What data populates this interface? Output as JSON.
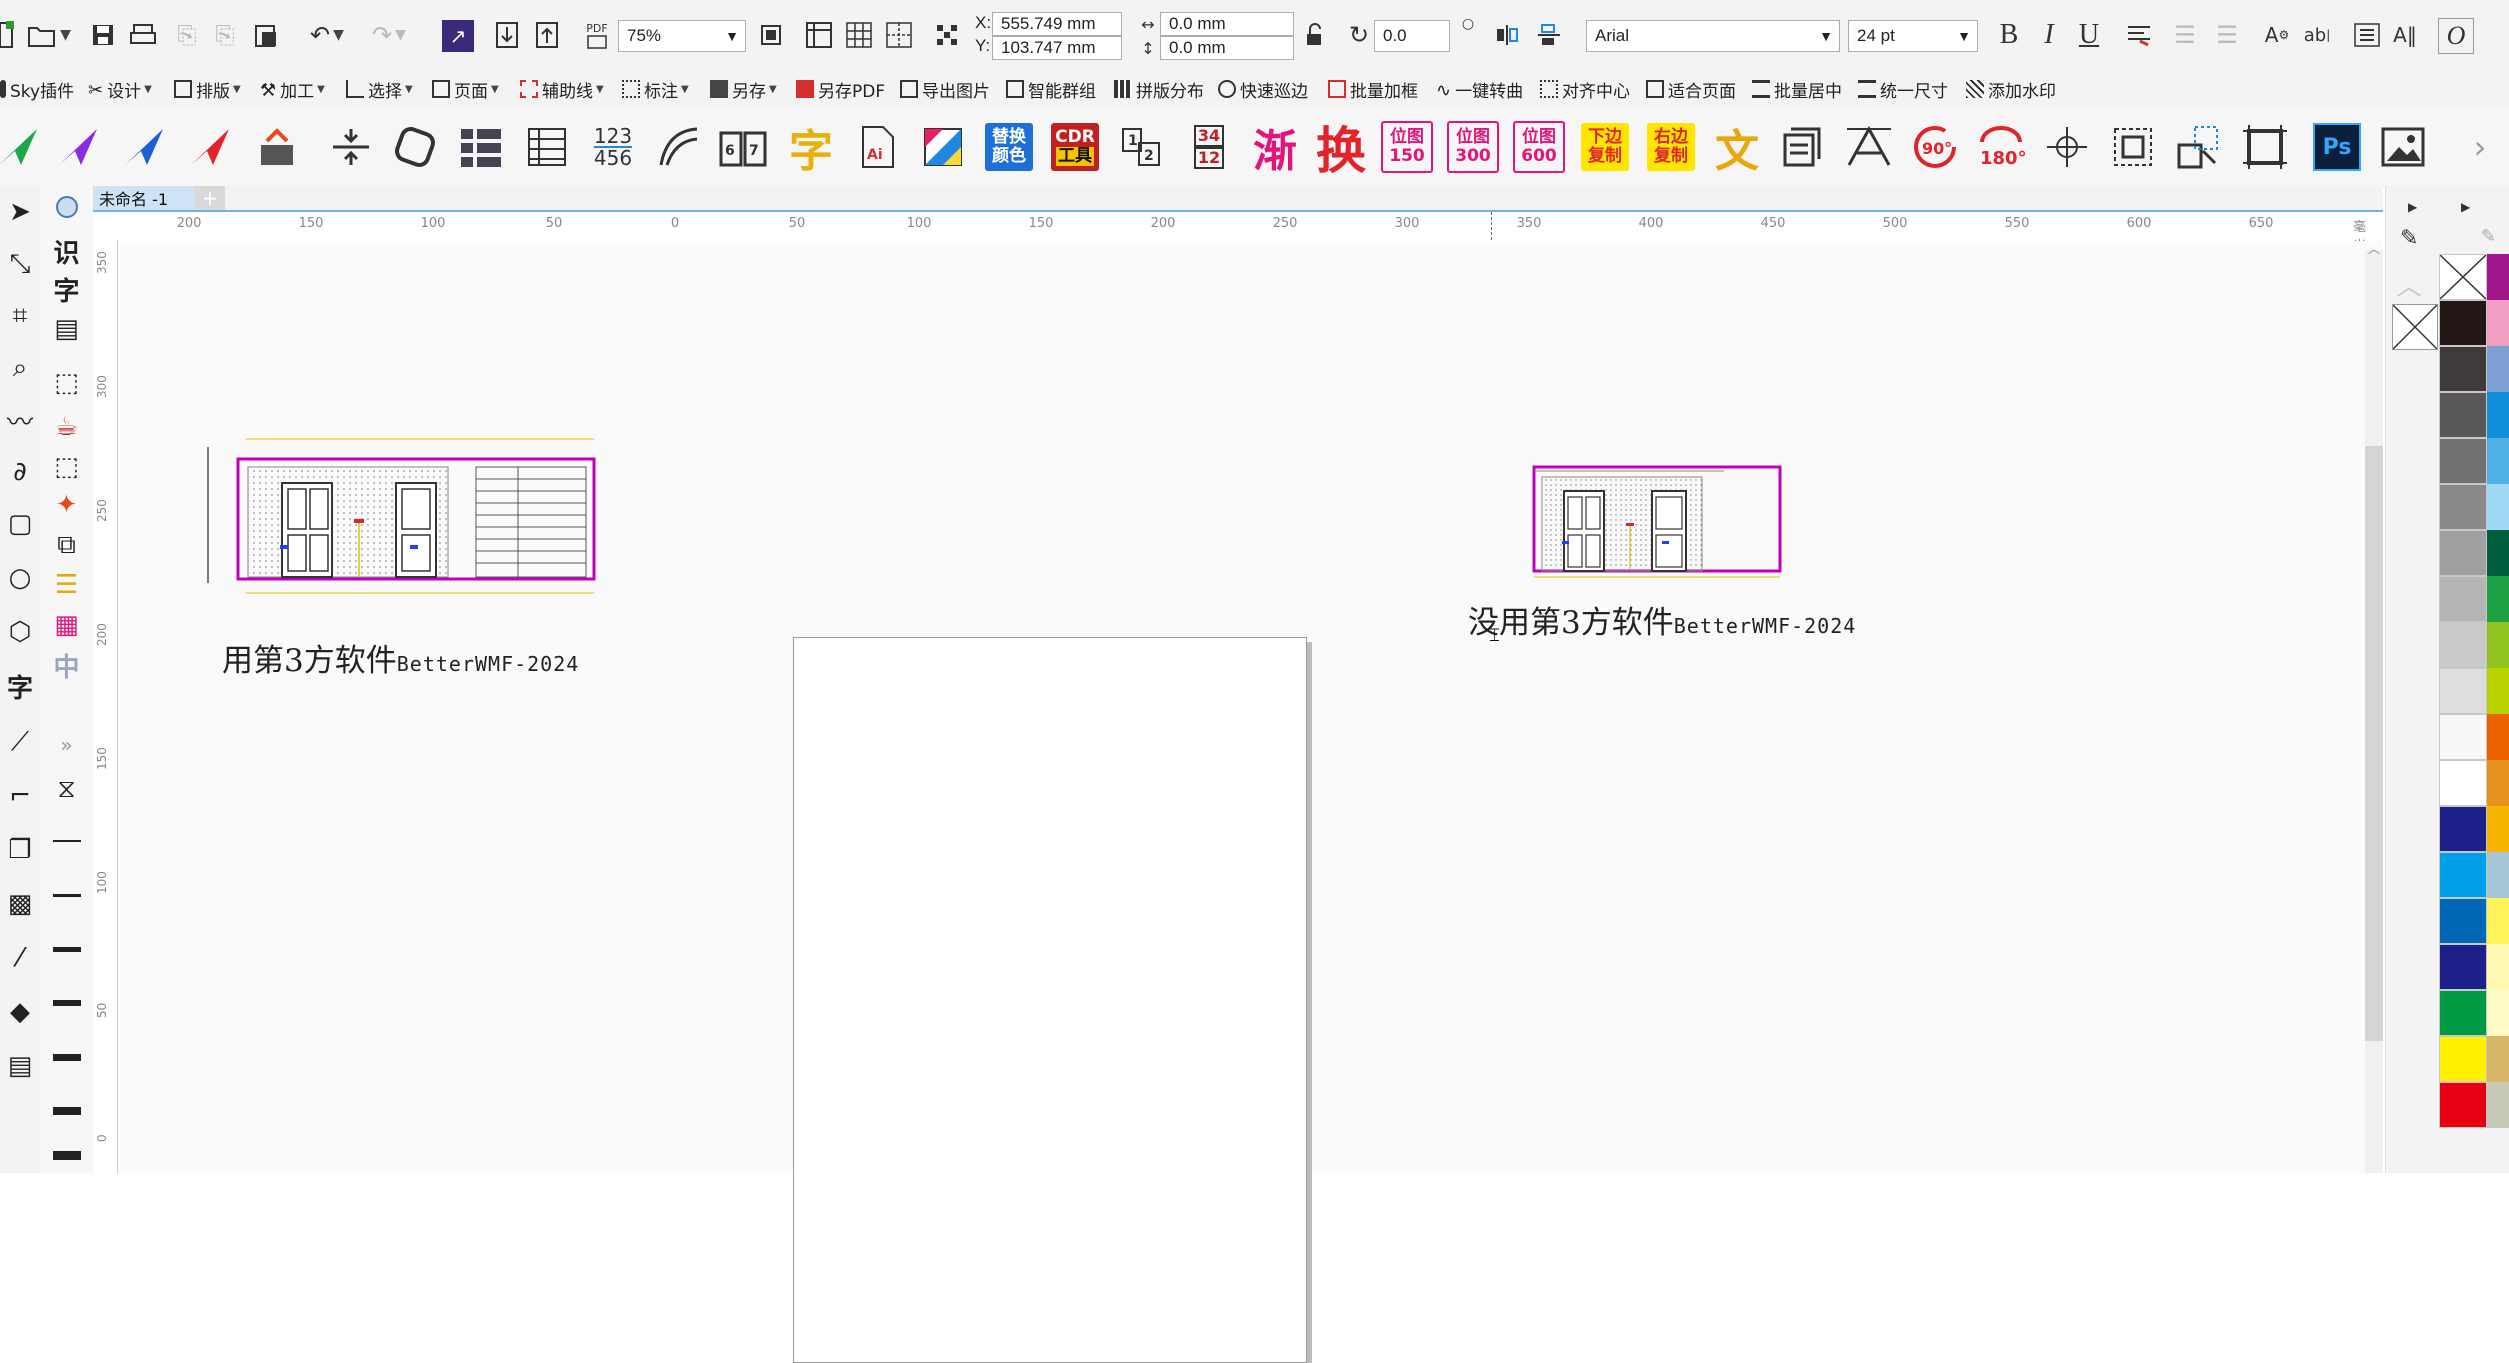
{
  "standard_toolbar": {
    "pdf_label": "PDF",
    "zoom": "75%",
    "x_label": "X:",
    "x_value": "555.749 mm",
    "y_label": "Y:",
    "y_value": "103.747 mm",
    "width_value": "0.0 mm",
    "height_value": "0.0 mm",
    "angle_value": "0.0",
    "font_name": "Arial",
    "font_size": "24 pt",
    "bold": "B",
    "italic": "I",
    "underline": "U"
  },
  "plugin_menu": [
    {
      "label": "Sky插件",
      "icon": "sky-icon"
    },
    {
      "label": "设计",
      "icon": "design-icon",
      "dropdown": true
    },
    {
      "label": "排版",
      "icon": "layout-icon",
      "dropdown": true
    },
    {
      "label": "加工",
      "icon": "process-icon",
      "dropdown": true
    },
    {
      "label": "选择",
      "icon": "select-icon",
      "dropdown": true
    },
    {
      "label": "页面",
      "icon": "page-icon",
      "dropdown": true
    },
    {
      "label": "辅助线",
      "icon": "guideline-icon",
      "dropdown": true
    },
    {
      "label": "标注",
      "icon": "dimension-icon",
      "dropdown": true
    },
    {
      "label": "另存",
      "icon": "save-as-icon",
      "dropdown": true
    },
    {
      "label": "另存PDF",
      "icon": "pdf-icon"
    },
    {
      "label": "导出图片",
      "icon": "export-image-icon"
    },
    {
      "label": "智能群组",
      "icon": "smart-group-icon"
    },
    {
      "label": "拼版分布",
      "icon": "impose-icon"
    },
    {
      "label": "快速巡边",
      "icon": "trace-edge-icon"
    },
    {
      "label": "批量加框",
      "icon": "batch-frame-icon"
    },
    {
      "label": "一键转曲",
      "icon": "to-curve-icon"
    },
    {
      "label": "对齐中心",
      "icon": "align-center-icon"
    },
    {
      "label": "适合页面",
      "icon": "fit-page-icon"
    },
    {
      "label": "批量居中",
      "icon": "batch-center-icon"
    },
    {
      "label": "统一尺寸",
      "icon": "uniform-size-icon"
    },
    {
      "label": "添加水印",
      "icon": "watermark-icon"
    }
  ],
  "icon_bar": {
    "chip_replace_color": [
      "替换",
      "颜色"
    ],
    "chip_cdr_tool": [
      "CDR",
      "工具"
    ],
    "num_123": "123",
    "num_456": "456",
    "num_34": "34",
    "num_12": "12",
    "gradient": "渐",
    "swap": "换",
    "bitmap_150": [
      "位图",
      "150"
    ],
    "bitmap_300": [
      "位图",
      "300"
    ],
    "bitmap_600": [
      "位图",
      "600"
    ],
    "copy_bottom": [
      "下边",
      "复制"
    ],
    "copy_right": [
      "右边",
      "复制"
    ],
    "wen": "文",
    "rotate_90": "90°",
    "rotate_180": "180°",
    "ps_label": "Ps",
    "zi": "字"
  },
  "document_tab": {
    "name": "未命名 -1",
    "add": "+"
  },
  "ruler": {
    "unit": "毫米",
    "h_ticks": [
      "200",
      "150",
      "100",
      "50",
      "0",
      "50",
      "100",
      "150",
      "200",
      "250",
      "300",
      "350",
      "400",
      "450",
      "500",
      "550",
      "600",
      "650"
    ],
    "v_ticks": [
      "350",
      "300",
      "250",
      "200",
      "150",
      "100",
      "50",
      "0"
    ]
  },
  "toolbox2": {
    "recognize": "识",
    "zi": "字",
    "zhong": "中"
  },
  "canvas": {
    "left_caption_cn": "用第3方软件",
    "left_caption_en": "BetterWMF-2024",
    "right_caption_cn": "没用第3方软件",
    "right_caption_en": "BetterWMF-2024"
  },
  "colors": {
    "accent_blue": "#6cb3e8",
    "drawing_magenta": "#c000c0",
    "drawing_yellow": "#e0c000"
  }
}
